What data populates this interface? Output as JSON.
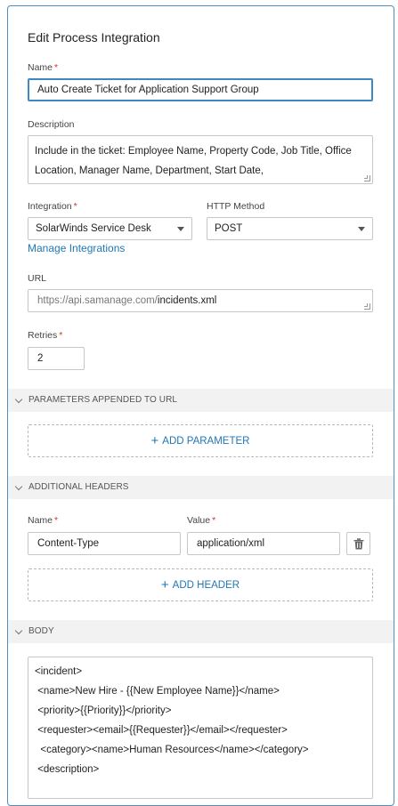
{
  "form": {
    "title": "Edit Process Integration",
    "name_label": "Name",
    "name_value": "Auto Create Ticket for Application Support Group",
    "description_label": "Description",
    "description_value": "Include in the ticket: Employee Name, Property Code, Job Title, Office Location, Manager Name, Department, Start Date,",
    "integration_label": "Integration",
    "integration_value": "SolarWinds Service Desk",
    "http_method_label": "HTTP Method",
    "http_method_value": "POST",
    "manage_integrations_link": "Manage Integrations",
    "url_label": "URL",
    "url_base": "https://api.samanage.com/",
    "url_path": "incidents.xml",
    "retries_label": "Retries",
    "retries_value": "2",
    "required_marker": "*"
  },
  "parameters_section": {
    "title": "PARAMETERS APPENDED TO URL",
    "add_button": "ADD PARAMETER"
  },
  "headers_section": {
    "title": "ADDITIONAL HEADERS",
    "name_label": "Name",
    "value_label": "Value",
    "header_name": "Content-Type",
    "header_value": "application/xml",
    "add_button": "ADD HEADER"
  },
  "body_section": {
    "title": "BODY",
    "lines": [
      "<incident>",
      " <name>New Hire - {{New Employee Name}}</name>",
      " <priority>{{Priority}}</priority>",
      " <requester><email>{{Requester}}</email></requester>",
      "  <category><name>Human Resources</name></category>",
      " <description>"
    ]
  },
  "icons": {
    "plus": "plus-icon",
    "trash": "trash-icon",
    "chevron": "chevron-down-icon",
    "caret": "caret-down-icon"
  },
  "colors": {
    "accent": "#1f77b4",
    "required": "#d0342c",
    "focus_border": "#3d87c5"
  }
}
